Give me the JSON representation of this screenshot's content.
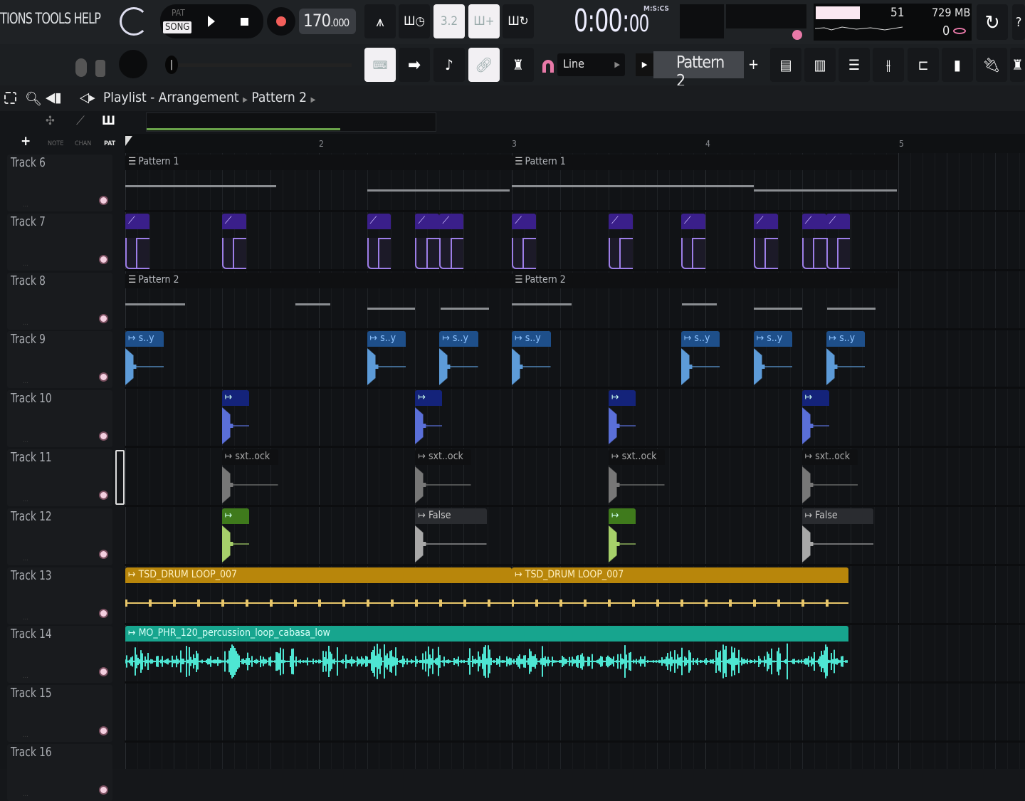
{
  "menu": {
    "text": "TIONS TOOLS HELP"
  },
  "transport": {
    "pat": "PAT",
    "song": "SONG",
    "tempo_int": "170",
    "tempo_dec": ".000",
    "time_main": "0:00:",
    "time_cs": "00",
    "time_format": "M:S:CS"
  },
  "monitor": {
    "cpu": "51",
    "memory": "729 MB",
    "polyphony": "0"
  },
  "snap": {
    "label": "Line"
  },
  "pattern_selector": {
    "label": "Pattern 2",
    "add": "+"
  },
  "breadcrumb": {
    "items": [
      "Playlist - Arrangement",
      "Pattern 2"
    ]
  },
  "picker": {
    "add": "+",
    "note": "NOTE",
    "chan": "CHAN",
    "pat": "PAT"
  },
  "ruler": {
    "bars": [
      "2",
      "3",
      "4",
      "5"
    ]
  },
  "tracks": [
    "Track 6",
    "Track 7",
    "Track 8",
    "Track 9",
    "Track 10",
    "Track 11",
    "Track 12",
    "Track 13",
    "Track 14",
    "Track 15",
    "Track 16"
  ],
  "colors": {
    "automation": "#3a1f8a",
    "sample_blue": "#1e4f8a",
    "wave_blue": "#5d9bd8",
    "dark_blue": "#14237a",
    "wave_indigo": "#5a6fd8",
    "green": "#3f7a1c",
    "wave_green": "#a6d06a",
    "gold": "#b8860b",
    "wave_gold": "#e8c66a",
    "teal": "#17a58e",
    "wave_teal": "#4ee6d3",
    "accent_pink": "#e879a8"
  },
  "clips": [
    {
      "track": 0,
      "type": "pattern",
      "label": "Pattern 1",
      "start": 1,
      "length": 2,
      "notes": [
        [
          1,
          1.78,
          0
        ],
        [
          2.25,
          2.99,
          1
        ]
      ]
    },
    {
      "track": 0,
      "type": "pattern",
      "label": "Pattern 1",
      "start": 3,
      "length": 2,
      "notes": [
        [
          3,
          4.25,
          0
        ],
        [
          4.25,
          4.99,
          1
        ]
      ]
    },
    {
      "track": 2,
      "type": "pattern",
      "label": "Pattern 2",
      "start": 1,
      "length": 2,
      "notes": [
        [
          1,
          1.31,
          0
        ],
        [
          1.88,
          2.06,
          0
        ],
        [
          2.25,
          2.5,
          1
        ],
        [
          2.63,
          2.88,
          1
        ]
      ]
    },
    {
      "track": 2,
      "type": "pattern",
      "label": "Pattern 2",
      "start": 3,
      "length": 2,
      "notes": [
        [
          3,
          3.31,
          0
        ],
        [
          3.88,
          4.06,
          0
        ],
        [
          4.25,
          4.5,
          1
        ],
        [
          4.63,
          4.88,
          1
        ]
      ]
    },
    {
      "track": 1,
      "type": "automation",
      "starts": [
        1,
        1.5,
        2.25,
        2.5,
        2.625,
        3,
        3.5,
        3.875,
        4.25,
        4.5,
        4.625
      ],
      "length": 0.125
    },
    {
      "track": 3,
      "type": "sample",
      "label": "s..y",
      "color": "sample_blue",
      "wave": "wave_blue",
      "starts": [
        1,
        2.25,
        2.625,
        3,
        3.875,
        4.25,
        4.625
      ],
      "length": 0.2
    },
    {
      "track": 4,
      "type": "sample",
      "label": "",
      "color": "dark_blue",
      "wave": "wave_indigo",
      "starts": [
        1.5,
        2.5,
        3.5,
        4.5
      ],
      "length": 0.14
    },
    {
      "track": 5,
      "type": "sample",
      "label": "sxt..ock",
      "color": "none",
      "wave": "grey",
      "starts": [
        1.5,
        2.5,
        3.5,
        4.5
      ],
      "length": 0.29
    },
    {
      "track": 6,
      "type": "sample",
      "label": "",
      "color": "green",
      "wave": "wave_green",
      "starts": [
        1.5,
        3.5
      ],
      "length": 0.14
    },
    {
      "track": 6,
      "type": "sample",
      "label": "False",
      "color": "grey",
      "wave": "grey",
      "starts": [
        2.5,
        4.5
      ],
      "length": 0.37
    },
    {
      "track": 7,
      "type": "loop",
      "label": "TSD_DRUM LOOP_007",
      "color": "gold",
      "wave": "wave_gold",
      "starts": [
        1
      ],
      "length": 2
    },
    {
      "track": 7,
      "type": "loop",
      "label": "TSD_DRUM LOOP_007",
      "color": "gold",
      "wave": "wave_gold",
      "starts": [
        3
      ],
      "length": 1.74
    },
    {
      "track": 8,
      "type": "loop",
      "label": "MO_PHR_120_percussion_loop_cabasa_low",
      "color": "teal",
      "wave": "wave_teal",
      "starts": [
        1
      ],
      "length": 3.74
    }
  ]
}
